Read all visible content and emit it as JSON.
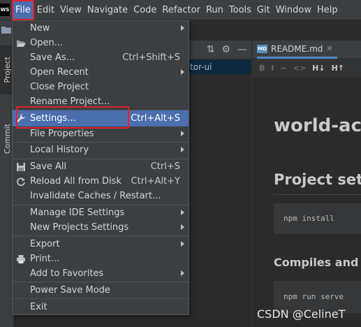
{
  "app_logo_text": "WS",
  "menubar": [
    {
      "label": "File",
      "active": true
    },
    {
      "label": "Edit"
    },
    {
      "label": "View"
    },
    {
      "label": "Navigate"
    },
    {
      "label": "Code"
    },
    {
      "label": "Refactor"
    },
    {
      "label": "Run"
    },
    {
      "label": "Tools"
    },
    {
      "label": "Git"
    },
    {
      "label": "Window"
    },
    {
      "label": "Help"
    }
  ],
  "toolstrip": {
    "project_label": "Project",
    "commit_label": "Commit"
  },
  "project_panel": {
    "row_text": "tor-ui"
  },
  "file_menu": {
    "items": [
      {
        "label": "New",
        "submenu": true
      },
      {
        "label": "Open..."
      },
      {
        "label": "Save As...",
        "shortcut": "Ctrl+Shift+S"
      },
      {
        "label": "Open Recent",
        "submenu": true
      },
      {
        "label": "Close Project"
      },
      {
        "label": "Rename Project..."
      },
      {
        "label": "Settings...",
        "shortcut": "Ctrl+Alt+S",
        "highlighted": true
      },
      {
        "label": "File Properties",
        "submenu": true
      },
      {
        "label": "Local History",
        "submenu": true
      },
      {
        "label": "Save All",
        "shortcut": "Ctrl+S"
      },
      {
        "label": "Reload All from Disk",
        "shortcut": "Ctrl+Alt+Y"
      },
      {
        "label": "Invalidate Caches / Restart..."
      },
      {
        "label": "Manage IDE Settings",
        "submenu": true
      },
      {
        "label": "New Projects Settings",
        "submenu": true
      },
      {
        "label": "Export",
        "submenu": true
      },
      {
        "label": "Print..."
      },
      {
        "label": "Add to Favorites",
        "submenu": true
      },
      {
        "label": "Power Save Mode"
      },
      {
        "label": "Exit"
      }
    ]
  },
  "editor": {
    "tab_label": "README.md",
    "tab_icon_text": "MD",
    "toolbar": [
      "B",
      "I",
      "̶",
      "<>",
      "H↓",
      "H↑"
    ],
    "preview": {
      "h1": "world-ac",
      "h2": "Project set",
      "code1": "npm install",
      "h3": "Compiles and",
      "code2": "npm run serve"
    }
  },
  "watermark": "CSDN @CelineT",
  "colors": {
    "accent": "#4b6eaf",
    "annotation": "#e0212b",
    "menu_bg": "#3c3f41"
  }
}
